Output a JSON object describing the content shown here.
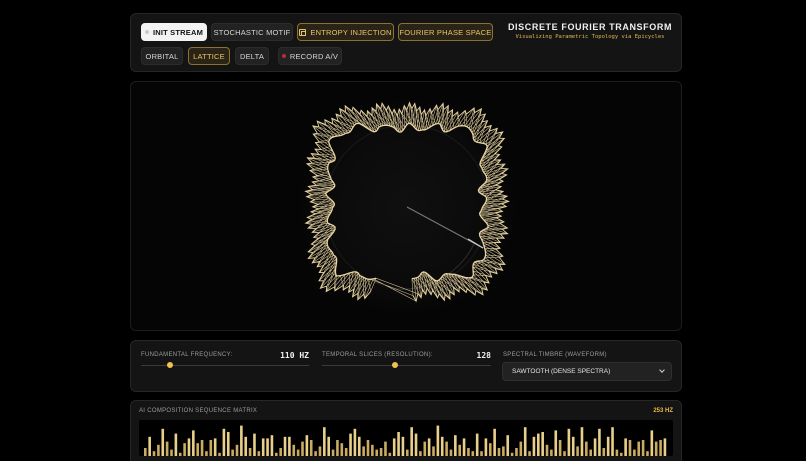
{
  "toolbar": {
    "row1": [
      {
        "label": "INIT STREAM",
        "style": "primary",
        "icon": "dot"
      },
      {
        "label": "STOCHASTIC MOTIF",
        "style": "dark",
        "icon": ""
      },
      {
        "label": "ENTROPY INJECTION",
        "style": "gold",
        "icon": "square"
      },
      {
        "label": "FOURIER PHASE SPACE",
        "style": "gold",
        "icon": ""
      }
    ],
    "row2": [
      {
        "label": "ORBITAL",
        "style": "dark",
        "icon": ""
      },
      {
        "label": "LATTICE",
        "style": "gold",
        "icon": ""
      },
      {
        "label": "DELTA",
        "style": "dark",
        "icon": ""
      },
      {
        "label": "RECORD A/V",
        "style": "dark",
        "icon": "red-dot"
      }
    ]
  },
  "header": {
    "title": "DISCRETE FOURIER TRANSFORM",
    "subtitle": "Visualizing Parametric Topology via Epicycles"
  },
  "controls": {
    "frequency": {
      "label": "FUNDAMENTAL FREQUENCY:",
      "value": "110 HZ",
      "fraction": 0.17
    },
    "slices": {
      "label": "TEMPORAL SLICES (RESOLUTION):",
      "value": "128",
      "fraction": 0.43
    },
    "timbre": {
      "label": "SPECTRAL TIMBRE (WAVEFORM)",
      "selected": "SAWTOOTH (DENSE SPECTRA)"
    }
  },
  "matrix": {
    "title": "AI COMPOSITION SEQUENCE MATRIX",
    "hz": "253 HZ",
    "levels": [
      0.25,
      0.6,
      0.15,
      0.35,
      0.85,
      0.45,
      0.2,
      0.7,
      0.1,
      0.4,
      0.55,
      0.8,
      0.4,
      0.5,
      0.15,
      0.5,
      0.55,
      0.1,
      0.85,
      0.75,
      0.2,
      0.35,
      0.95,
      0.6,
      0.25,
      0.7,
      0.15,
      0.55,
      0.55,
      0.65,
      0.1,
      0.25,
      0.6,
      0.6,
      0.35,
      0.2,
      0.45,
      0.65,
      0.5,
      0.15,
      0.3,
      0.9,
      0.6,
      0.2,
      0.5,
      0.4,
      0.25,
      0.7,
      0.85,
      0.6,
      0.3,
      0.5,
      0.35,
      0.2,
      0.25,
      0.45,
      0.1,
      0.55,
      0.75,
      0.6,
      0.2,
      0.9,
      0.7,
      0.15,
      0.45,
      0.55,
      0.3,
      0.95,
      0.6,
      0.45,
      0.2,
      0.65,
      0.35,
      0.55,
      0.25,
      0.15,
      0.7,
      0.15,
      0.55,
      0.4,
      0.85,
      0.25,
      0.3,
      0.65,
      0.1,
      0.25,
      0.45,
      0.9,
      0.15,
      0.6,
      0.7,
      0.75,
      0.35,
      0.2,
      0.8,
      0.5,
      0.15,
      0.85,
      0.6,
      0.3,
      0.9,
      0.45,
      0.2,
      0.55,
      0.85,
      0.25,
      0.6,
      0.9,
      0.2,
      0.1,
      0.55,
      0.5,
      0.2,
      0.45,
      0.5,
      0.15,
      0.8,
      0.45,
      0.5,
      0.55
    ]
  },
  "colors": {
    "accent": "#f2c14e",
    "bar": "#e8cf8a",
    "bar_dim": "#c9ab62",
    "figure": "#ead6a3"
  }
}
